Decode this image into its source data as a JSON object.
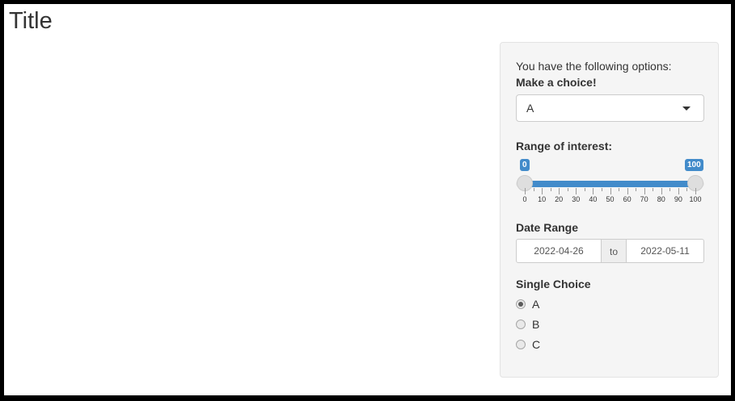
{
  "page": {
    "title": "Title"
  },
  "sidebar": {
    "intro_text": "You have the following options:",
    "select": {
      "label": "Make a choice!",
      "value": "A"
    },
    "slider": {
      "label": "Range of interest:",
      "min": 0,
      "max": 100,
      "value_low": 0,
      "value_high": 100,
      "value_low_label": "0",
      "value_high_label": "100",
      "tick_labels": [
        "0",
        "10",
        "20",
        "30",
        "40",
        "50",
        "60",
        "70",
        "80",
        "90",
        "100"
      ],
      "accent_color": "#428bca"
    },
    "date_range": {
      "label": "Date Range",
      "start": "2022-04-26",
      "separator": "to",
      "end": "2022-05-11"
    },
    "radio": {
      "label": "Single Choice",
      "options": [
        "A",
        "B",
        "C"
      ],
      "selected_index": 0
    }
  }
}
